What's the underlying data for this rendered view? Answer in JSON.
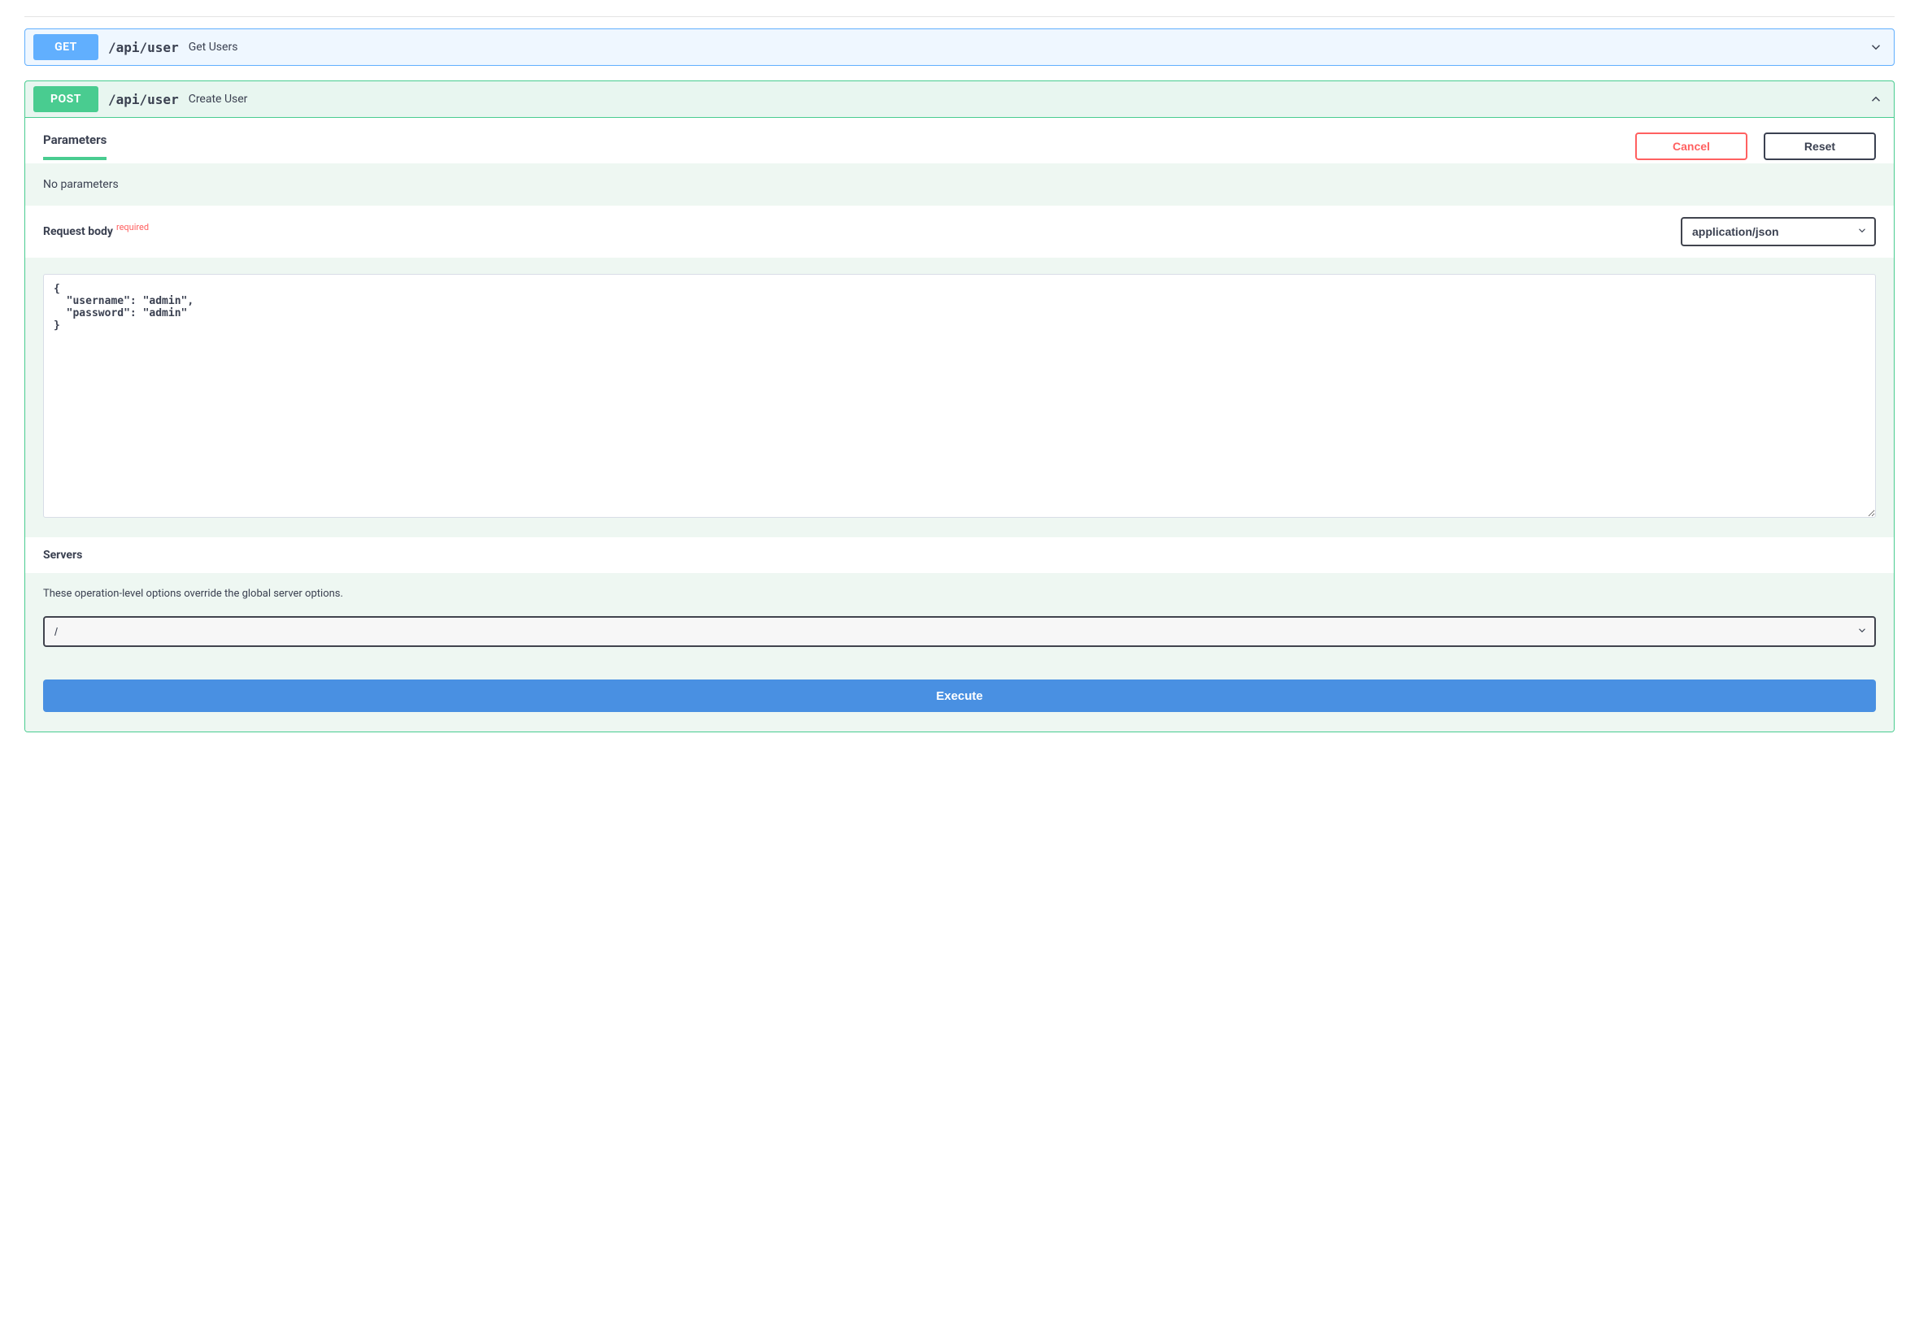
{
  "endpoints": {
    "get_user": {
      "method": "GET",
      "path": "/api/user",
      "summary": "Get Users"
    },
    "post_user": {
      "method": "POST",
      "path": "/api/user",
      "summary": "Create User"
    }
  },
  "parameters": {
    "tab_label": "Parameters",
    "cancel_label": "Cancel",
    "reset_label": "Reset",
    "no_params_text": "No parameters"
  },
  "request_body": {
    "label": "Request body",
    "required_tag": "required",
    "content_type": "application/json",
    "body_text": "{\n  \"username\": \"admin\",\n  \"password\": \"admin\"\n}"
  },
  "servers": {
    "title": "Servers",
    "note": "These operation-level options override the global server options.",
    "selected": "/"
  },
  "execute_label": "Execute"
}
